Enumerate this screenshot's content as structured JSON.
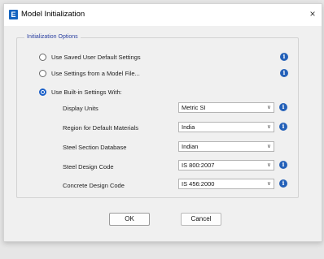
{
  "window": {
    "title": "Model Initialization",
    "app_icon_letter": "E",
    "close_glyph": "×"
  },
  "group": {
    "title": "Initialization Options"
  },
  "options": [
    {
      "label": "Use Saved User Default Settings",
      "selected": false
    },
    {
      "label": "Use Settings from a Model File...",
      "selected": false
    },
    {
      "label": "Use Built-in Settings With:",
      "selected": true
    }
  ],
  "fields": [
    {
      "label": "Display Units",
      "value": "Metric SI",
      "has_info": true
    },
    {
      "label": "Region for Default Materials",
      "value": "India",
      "has_info": true
    },
    {
      "label": "Steel Section Database",
      "value": "Indian",
      "has_info": false
    },
    {
      "label": "Steel Design Code",
      "value": "IS 800:2007",
      "has_info": true
    },
    {
      "label": "Concrete Design Code",
      "value": "IS 456:2000",
      "has_info": true
    }
  ],
  "buttons": {
    "ok": "OK",
    "cancel": "Cancel"
  },
  "icons": {
    "info": "i",
    "chevron": "∨"
  },
  "colors": {
    "accent": "#1a5fc8",
    "group_title": "#2a3fa0",
    "info_icon": "#2360b8"
  }
}
